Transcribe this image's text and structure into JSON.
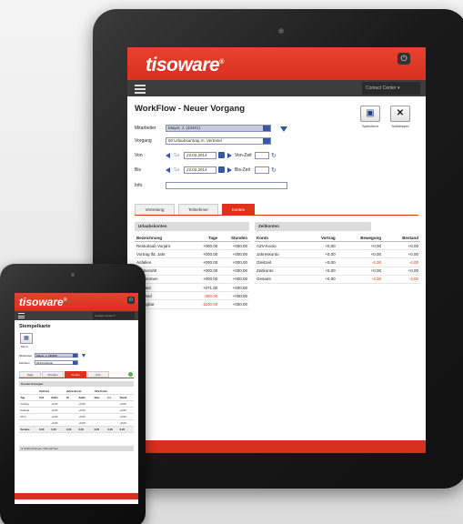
{
  "tablet": {
    "logo": "tisoware",
    "logo_mark": "®",
    "user_menu": "Contact Center ▾",
    "page_title": "WorkFlow - Neuer Vorgang",
    "toolbar": {
      "save_label": "Speichern",
      "cancel_label": "Schliessen"
    },
    "form": {
      "mitarbeiter_label": "Mitarbeiter",
      "mitarbeiter_value": "Mayer, J. (40401)",
      "vorgang_label": "Vorgang",
      "vorgang_value": "60 Urlaubsantrag m. Vertreter",
      "von_label": "Von",
      "von_date": "22.02.2014",
      "von_zeit_label": "Von-Zeit",
      "bis_label": "Bis",
      "bis_date": "22.02.2014",
      "bis_zeit_label": "Bis-Zeit",
      "info_label": "Info",
      "day_prefix": "Sa"
    },
    "tabs": [
      {
        "label": "Vertretung"
      },
      {
        "label": "Teilnehmer"
      },
      {
        "label": "Konten"
      }
    ],
    "urlaub": {
      "title": "Urlaubskonten",
      "headers": [
        "Bezeichnung",
        "Tage",
        "Stunden"
      ],
      "rows": [
        [
          "Resturlaub Vorjahr",
          "+000.00",
          "+000.00"
        ],
        [
          "Vortrag lfd. Jahr",
          "+000.00",
          "+000.00"
        ],
        [
          "Anfallen",
          "+000.00",
          "+000.00"
        ],
        [
          "Ausbezahlt",
          "+000.00",
          "+000.00"
        ],
        [
          "Genommen",
          "+000.00",
          "+000.00"
        ],
        [
          "Geplant",
          "+071.00",
          "+000.00"
        ],
        [
          "Restand",
          "-350.00",
          "+000.00"
        ],
        [
          "Verfügbar",
          "-1100.00",
          "+000.00"
        ]
      ]
    },
    "zeit": {
      "title": "Zeitkonten",
      "headers": [
        "Konto",
        "Vortrag",
        "Bewegung",
        "Bestand"
      ],
      "rows": [
        [
          "AZV-Konto",
          "+0,00",
          "+0,00",
          "+0,00"
        ],
        [
          "Jahreskonto",
          "+0,00",
          "+0,00",
          "+0,00"
        ],
        [
          "Gleitzeit",
          "+0,00",
          "-4,00",
          "-4,00"
        ],
        [
          "Zeitkonto",
          "+0,00",
          "+0,00",
          "+0,00"
        ],
        [
          "Gesamt",
          "+0,00",
          "-4,00",
          "-4,00"
        ]
      ]
    }
  },
  "phone": {
    "logo": "tisoware",
    "logo_mark": "®",
    "user_menu": "Contact Center ▾",
    "page_title": "Stempelkarte",
    "icon_label": "Menü",
    "mitarbeiter_label": "Mitarbeiter",
    "mitarbeiter_value": "Mayer, J. (40401)",
    "zeitraum_label": "Zeitraum",
    "zeitraum_value": "2014 Februar",
    "tabs": [
      {
        "label": "Tage"
      },
      {
        "label": "Stunden"
      },
      {
        "label": "Konten"
      },
      {
        "label": "Antr."
      }
    ],
    "section_title": "Konten Anzeigen",
    "group_headers": [
      "",
      "Gleitzeit",
      "Jahreskonto",
      "AZV-Konto"
    ],
    "headers": [
      "Tag",
      "Soll",
      "Saldo",
      "Ist",
      "Saldo",
      "Bew.",
      "Ist",
      "Stand"
    ],
    "rows": [
      [
        "Vortrag",
        "",
        "+0,00",
        "",
        "+0,00",
        "",
        "",
        "+0,00"
      ],
      [
        "Februar",
        "",
        "+0,00",
        "",
        "+0,00",
        "",
        "",
        "+0,00"
      ],
      [
        "Mo 1",
        "",
        "+0,00",
        "",
        "+0,00",
        "",
        "",
        "+0,00"
      ],
      [
        "",
        "",
        "+0,00",
        "",
        "+0,00",
        "",
        "",
        "+0,00"
      ]
    ],
    "total_row": [
      "Summe",
      "0,00",
      "0,00",
      "0,00",
      "0,00",
      "0,00",
      "0,00",
      "0,00"
    ],
    "footer_section": "Zeitbuchungen übernehmen"
  }
}
